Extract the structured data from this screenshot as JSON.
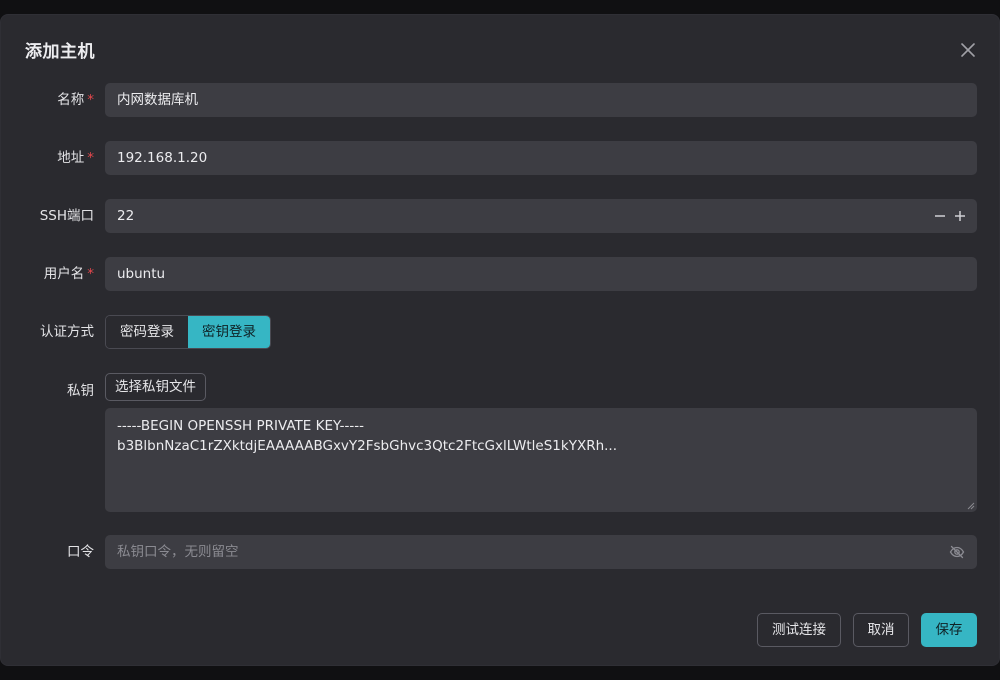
{
  "dialog": {
    "title": "添加主机"
  },
  "form": {
    "name": {
      "label": "名称",
      "required_mark": "*",
      "value": "内网数据库机"
    },
    "address": {
      "label": "地址",
      "required_mark": "*",
      "value": "192.168.1.20"
    },
    "ssh_port": {
      "label": "SSH端口",
      "value": "22"
    },
    "username": {
      "label": "用户名",
      "required_mark": "*",
      "value": "ubuntu"
    },
    "auth": {
      "label": "认证方式",
      "options": [
        "密码登录",
        "密钥登录"
      ],
      "selected": "密钥登录"
    },
    "private_key": {
      "label": "私钥",
      "choose_file_label": "选择私钥文件",
      "lines": [
        "-----BEGIN OPENSSH PRIVATE KEY-----",
        "b3BlbnNzaC1rZXktdjEAAAAABGxvY2FsbGhvc3Qtc2FtcGxlLWtleS1kYXRh..."
      ]
    },
    "passphrase": {
      "label": "口令",
      "placeholder": "私钥口令，无则留空"
    }
  },
  "footer": {
    "test_label": "测试连接",
    "cancel_label": "取消",
    "save_label": "保存"
  },
  "colors": {
    "accent": "#36b6c4",
    "required": "#e5484d",
    "panel": "#2a2a2f",
    "input": "#3d3d43"
  },
  "icons": {
    "close": "close-icon",
    "minus": "minus-icon",
    "plus": "plus-icon",
    "eye_off": "eye-off-icon"
  }
}
